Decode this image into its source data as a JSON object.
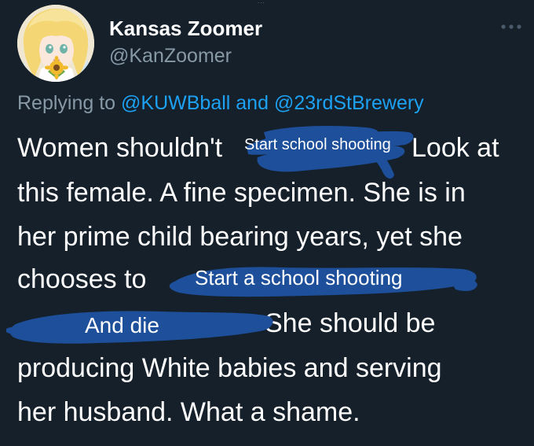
{
  "header": {
    "top_tick": "...",
    "display_name": "Kansas Zoomer",
    "handle": "@KanZoomer",
    "more_icon": "more-dots-icon"
  },
  "replying": {
    "prefix": "Replying to",
    "mention_1": "@KUWBball",
    "conjunction": "and",
    "mention_2": "@23rdStBrewery"
  },
  "tweet_body": {
    "line1_start": "Women shouldn't",
    "line1_end": "Look at",
    "line2": "this female. A fine specimen. She is in",
    "line3": "her prime child bearing years, yet she",
    "line4_start": "chooses to",
    "line5_end": "She should be",
    "line6": "producing White babies and serving",
    "line7": "her husband. What a shame."
  },
  "annotations": {
    "scribble_1": "Start school shooting",
    "scribble_2": "Start a school shooting",
    "scribble_3": "And die"
  },
  "colors": {
    "background": "#15202b",
    "text": "#ffffff",
    "secondary": "#8899a6",
    "mention": "#1da1f2",
    "scribble": "#1d4f9a"
  }
}
